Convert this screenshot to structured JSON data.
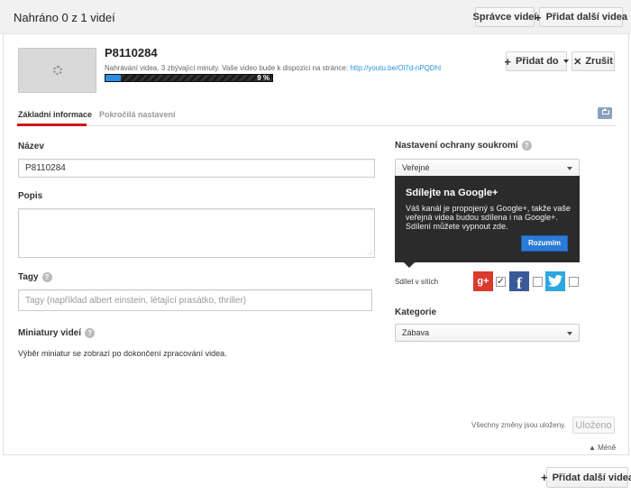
{
  "header": {
    "title": "Nahráno 0 z 1 videí",
    "manager_button": "Správce videí",
    "add_more_button": "Přidat další videa"
  },
  "video": {
    "title": "P8110284",
    "status_text": "Nahrávání videa. 3 zbývající minuty. Vaše video bude k dispozici na stránce:",
    "url": "http://youtu.be/Ol7d-nPQDhI",
    "progress_percent": 9,
    "progress_label": "9 %",
    "add_to_button": "Přidat do",
    "cancel_button": "Zrušit"
  },
  "tabs": [
    {
      "label": "Základní informace",
      "active": true
    },
    {
      "label": "Pokročilá nastavení",
      "active": false
    }
  ],
  "form": {
    "name_label": "Název",
    "name_value": "P8110284",
    "description_label": "Popis",
    "description_value": "",
    "tags_label": "Tagy",
    "tags_placeholder": "Tagy (například albert einstein, létající prasátko, thriller)",
    "thumbnails_label": "Miniatury videí",
    "thumbnails_text": "Výběr miniatur se zobrazí po dokončení zpracování videa."
  },
  "privacy": {
    "label": "Nastavení ochrany soukromí",
    "value": "Veřejné"
  },
  "promo": {
    "title": "Sdílejte na Google+",
    "body": "Váš kanál je propojený s Google+, takže vaše veřejná videa budou sdílena i na Google+. Sdílení můžete vypnout zde.",
    "button": "Rozumím"
  },
  "share": {
    "label": "Sdílet v sítích",
    "networks": [
      {
        "name": "Google+",
        "icon": "google-plus-icon",
        "glyph": "g+",
        "checked": true
      },
      {
        "name": "Facebook",
        "icon": "facebook-icon",
        "glyph": "f",
        "checked": false
      },
      {
        "name": "Twitter",
        "icon": "twitter-icon",
        "checked": false
      }
    ]
  },
  "category": {
    "label": "Kategorie",
    "value": "Zábava"
  },
  "footer": {
    "saved_note": "Všechny změny jsou uloženy.",
    "saved_button": "Uloženo",
    "less_link": "▲ Méně",
    "add_more_button": "Přidat další videa"
  },
  "colors": {
    "accent_red": "#cc181e",
    "progress_blue": "#2b8ee4",
    "promo_button_blue": "#2b7bd6",
    "google_plus": "#d93a2b",
    "facebook": "#3b5998",
    "twitter": "#2da7e0"
  }
}
